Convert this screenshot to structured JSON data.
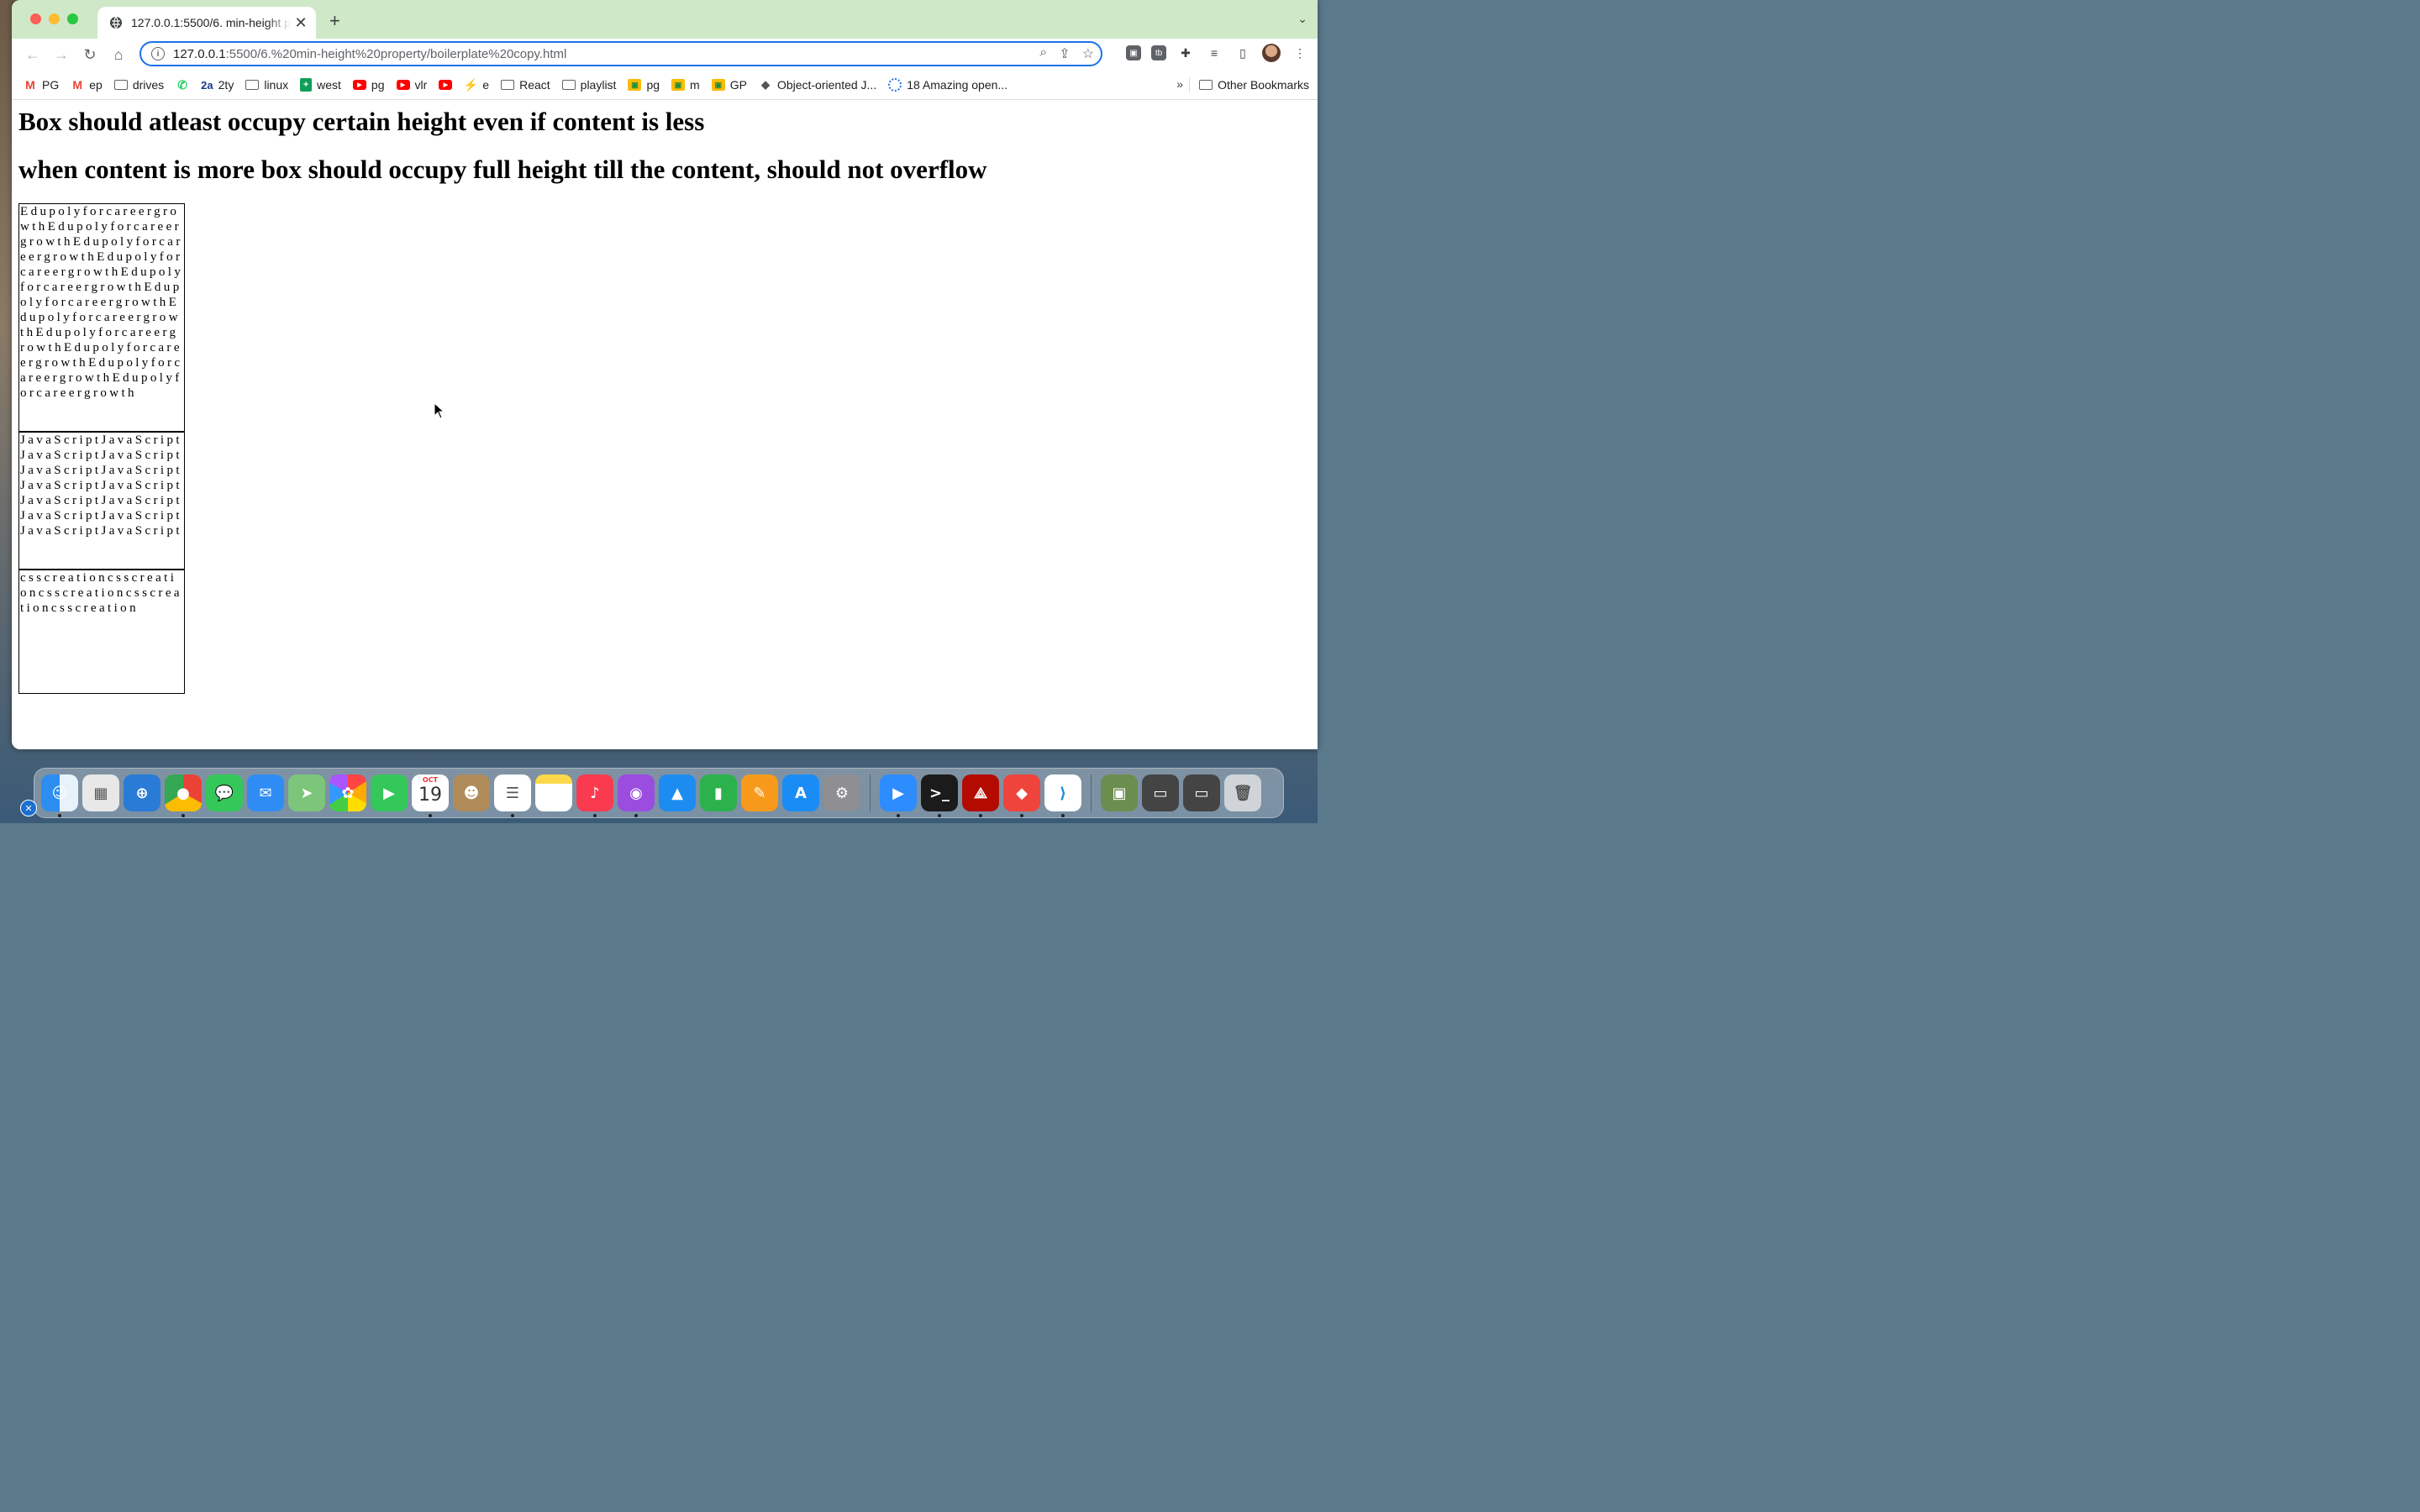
{
  "browser": {
    "tab_title": "127.0.0.1:5500/6. min-height p",
    "new_tab": "+",
    "tab_close": "✕",
    "url_host": "127.0.0.1",
    "url_path": ":5500/6.%20min-height%20property/boilerplate%20copy.html",
    "bookmarks": [
      {
        "label": "PG",
        "icon": "gmail-icon"
      },
      {
        "label": "ep",
        "icon": "gmail-icon"
      },
      {
        "label": "drives",
        "icon": "folder-icon"
      },
      {
        "label": "",
        "icon": "whatsapp-icon"
      },
      {
        "label": "2ty",
        "icon": "2a-icon"
      },
      {
        "label": "linux",
        "icon": "folder-icon"
      },
      {
        "label": "west",
        "icon": "sheets-icon"
      },
      {
        "label": "pg",
        "icon": "youtube-icon"
      },
      {
        "label": "vlr",
        "icon": "youtube-icon"
      },
      {
        "label": "",
        "icon": "youtube-icon"
      },
      {
        "label": "e",
        "icon": "bolt-icon"
      },
      {
        "label": "React",
        "icon": "folder-icon"
      },
      {
        "label": "playlist",
        "icon": "folder-icon"
      },
      {
        "label": "pg",
        "icon": "classroom-icon"
      },
      {
        "label": "m",
        "icon": "classroom-icon"
      },
      {
        "label": "GP",
        "icon": "classroom-icon"
      },
      {
        "label": "Object-oriented J...",
        "icon": "bird-icon"
      },
      {
        "label": "18 Amazing open...",
        "icon": "loading-icon"
      }
    ],
    "bookmarks_more": "»",
    "other_bookmarks": "Other Bookmarks",
    "tab_strip_color": "#cfe8c7",
    "accent_color": "#1a73e8"
  },
  "page": {
    "heading1": "Box should atleast occupy certain height even if content is less",
    "heading2": "when content is more box should occupy full height till the content, should not overflow",
    "box1": "EdupolyforcareergrowthEdupolyforcareergrowthEdupolyforcareergrowthEdupolyforcareergrowthEdupolyforcareergrowthEdupolyforcareergrowthEdupolyforcareergrowthEdupolyforcareergrowthEdupolyforcareergrowthEdupolyforcareergrowthEdupolyforcareergrowth",
    "box2": "JavaScriptJavaScriptJavaScriptJavaScriptJavaScriptJavaScriptJavaScriptJavaScriptJavaScriptJavaScriptJavaScriptJavaScriptJavaScriptJavaScript",
    "box3": "csscreationcsscreationcsscreationcsscreationcsscreation"
  },
  "dock": {
    "calendar_month": "OCT",
    "calendar_day": "19",
    "apps": [
      "finder-icon",
      "launchpad-icon",
      "safari-icon",
      "chrome-icon",
      "messages-icon",
      "mail-icon",
      "maps-icon",
      "photos-icon",
      "facetime-icon",
      "calendar-icon",
      "contacts-icon",
      "reminders-icon",
      "notes-icon",
      "music-icon",
      "podcasts-icon",
      "keynote-icon",
      "numbers-icon",
      "pages-icon",
      "app-store-icon",
      "system-preferences-icon",
      "zoom-icon",
      "terminal-icon",
      "acrobat-icon",
      "anydesk-icon",
      "vscode-icon",
      "image-thumbnail-icon",
      "screenshot-icon",
      "screenshot-icon",
      "trash-icon"
    ]
  }
}
